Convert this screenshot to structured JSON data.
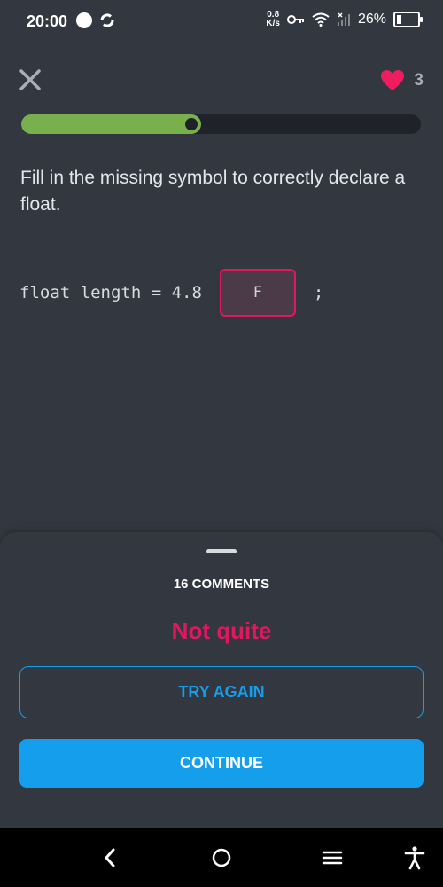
{
  "status_bar": {
    "time": "20:00",
    "speed_value": "0.8",
    "speed_unit": "K/s",
    "battery": "26%",
    "battery_level": 0.26
  },
  "lesson": {
    "hearts": "3",
    "progress": 0.45,
    "question": "Fill in the missing symbol to correctly declare a float.",
    "code_before": "float length = 4.8",
    "answer": "F",
    "code_after": ";"
  },
  "sheet": {
    "comments": "16 COMMENTS",
    "feedback": "Not quite",
    "try_again": "TRY AGAIN",
    "continue": "CONTINUE"
  },
  "colors": {
    "background": "#33373f",
    "progress": "#79b04e",
    "error": "#e0195f",
    "accent": "#149eec"
  },
  "icons": [
    "close-icon",
    "heart-icon",
    "back-icon",
    "home-icon",
    "menu-icon",
    "accessibility-icon"
  ]
}
